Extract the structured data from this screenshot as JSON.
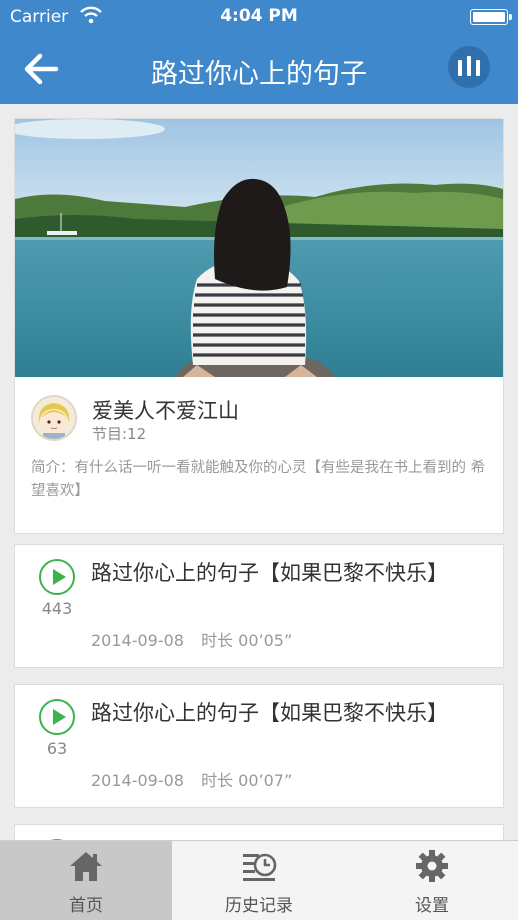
{
  "status_bar": {
    "carrier": "Carrier",
    "time": "4:04 PM"
  },
  "nav": {
    "title": "路过你心上的句子"
  },
  "program": {
    "name": "爱美人不爱江山",
    "episode_count": "节目:12",
    "intro": "简介：有什么话一听一看就能触及你的心灵【有些是我在书上看到的 希望喜欢】"
  },
  "episodes": [
    {
      "title": "路过你心上的句子【如果巴黎不快乐】",
      "plays": "443",
      "date": "2014-09-08",
      "duration": "时长 00’05”"
    },
    {
      "title": "路过你心上的句子【如果巴黎不快乐】",
      "plays": "63",
      "date": "2014-09-08",
      "duration": "时长 00’07”"
    }
  ],
  "tabs": [
    {
      "label": "首页",
      "icon": "home-icon",
      "active": true
    },
    {
      "label": "历史记录",
      "icon": "history-icon",
      "active": false
    },
    {
      "label": "设置",
      "icon": "gear-icon",
      "active": false
    }
  ],
  "colors": {
    "nav_blue": "#3f88cb",
    "play_green": "#3db34b"
  }
}
